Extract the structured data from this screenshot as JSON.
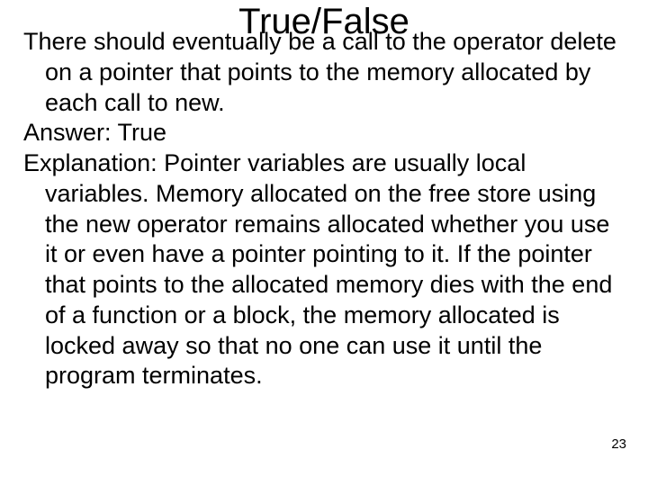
{
  "title": "True/False",
  "question": "There should eventually be a call to the operator delete on a pointer that points to the memory allocated by each call to new.",
  "answer_label": "Answer: ",
  "answer_value": "True",
  "explanation_label": "Explanation: ",
  "explanation_text": "Pointer variables are usually local variables. Memory allocated on the free store using the new operator remains allocated whether you use it or even have a pointer pointing to it. If the pointer that points to the allocated memory dies with the end of a function or a block, the memory allocated is locked away so that no one can use it until the program terminates.",
  "page_number": "23"
}
